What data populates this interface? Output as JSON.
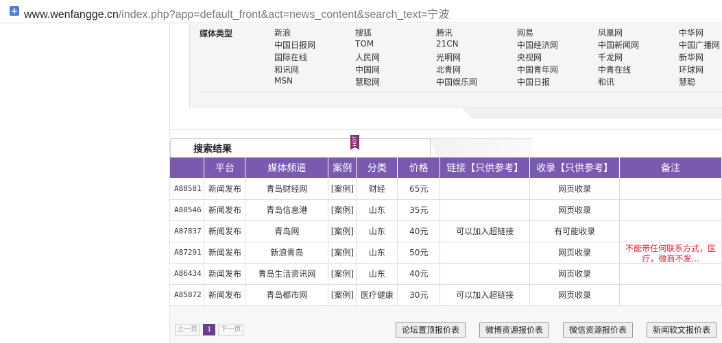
{
  "browser": {
    "url_host": "www.wenfangge.cn",
    "url_path": "/index.php?app=default_front&act=news_content&search_text=宁波"
  },
  "media_types": {
    "label": "媒体类型",
    "rows": [
      [
        "新浪",
        "搜狐",
        "腾讯",
        "网易",
        "凤凰网",
        "中华网"
      ],
      [
        "中国日报网",
        "TOM",
        "21CN",
        "中国经济网",
        "中国新闻网",
        "中国广播网"
      ],
      [
        "国际在线",
        "人民网",
        "光明网",
        "央视网",
        "千龙网",
        "新华网"
      ],
      [
        "和讯网",
        "中国网",
        "北青网",
        "中国青年网",
        "中青在线",
        "环球网"
      ],
      [
        "MSN",
        "慧聪网",
        "中国娱乐网",
        "中国日报",
        "和讯",
        "慧聪"
      ]
    ]
  },
  "results": {
    "tab_title": "搜索结果",
    "hot_badge": "HOT",
    "headers": [
      "",
      "平台",
      "媒体频道",
      "案例",
      "分类",
      "价格",
      "链接【只供参考】",
      "收录【只供参考】",
      "备注"
    ],
    "rows": [
      {
        "id": "A88581",
        "platform": "新闻发布",
        "channel": "青岛财经网",
        "case": "[案例]",
        "category": "财经",
        "price": "65元",
        "link": "",
        "index": "网页收录",
        "note": ""
      },
      {
        "id": "A88546",
        "platform": "新闻发布",
        "channel": "青岛信息港",
        "case": "[案例]",
        "category": "山东",
        "price": "35元",
        "link": "",
        "index": "网页收录",
        "note": ""
      },
      {
        "id": "A87837",
        "platform": "新闻发布",
        "channel": "青岛网",
        "case": "[案例]",
        "category": "山东",
        "price": "40元",
        "link": "可以加入超链接",
        "index": "有可能收录",
        "note": ""
      },
      {
        "id": "A87291",
        "platform": "新闻发布",
        "channel": "新浪青岛",
        "case": "[案例]",
        "category": "山东",
        "price": "50元",
        "link": "",
        "index": "网页收录",
        "note": "不能带任何联系方式，医疗，微商不发..."
      },
      {
        "id": "A86434",
        "platform": "新闻发布",
        "channel": "青岛生活资讯网",
        "case": "[案例]",
        "category": "山东",
        "price": "40元",
        "link": "",
        "index": "网页收录",
        "note": ""
      },
      {
        "id": "A85872",
        "platform": "新闻发布",
        "channel": "青岛都市网",
        "case": "[案例]",
        "category": "医疗健康",
        "price": "30元",
        "link": "可以加入超链接",
        "index": "网页收录",
        "note": ""
      }
    ]
  },
  "pager": {
    "prev": "上一页",
    "current": "1",
    "next": "下一页"
  },
  "price_buttons": [
    "论坛置顶报价表",
    "微博资源报价表",
    "微信资源报价表",
    "新闻软文报价表"
  ]
}
